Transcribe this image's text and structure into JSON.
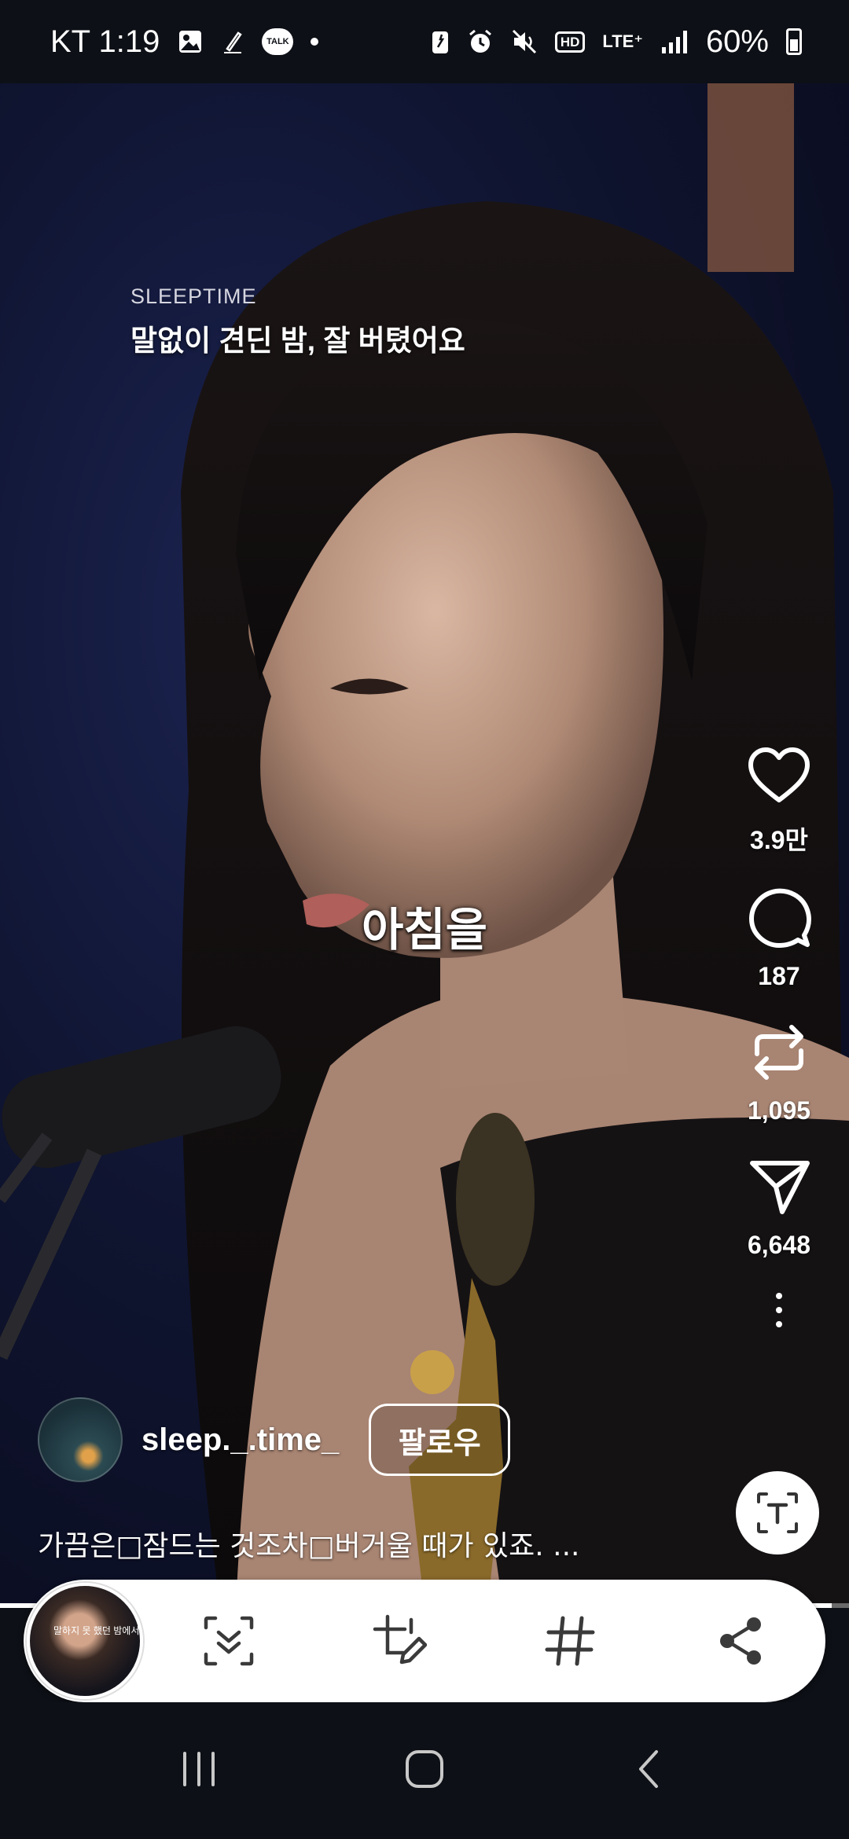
{
  "status_bar": {
    "carrier_time": "KT 1:19",
    "talk_label": "TALK",
    "hd_label": "HD",
    "network_label": "LTE⁺",
    "battery_percent": "60%"
  },
  "video": {
    "brand": "SLEEPTIME",
    "headline": "말없이 견딘 밤, 잘 버텼어요",
    "caption": "아침을",
    "thumb_text": "말하지 못 했던 밤에서"
  },
  "actions": {
    "likes": "3.9만",
    "comments": "187",
    "reposts": "1,095",
    "shares": "6,648"
  },
  "author": {
    "username": "sleep._.time_",
    "follow_label": "팔로우"
  },
  "description": "가끔은□잠드는 것조차□버거울 때가 있죠. ...",
  "progress": 0.98,
  "icons": {
    "like": "heart-icon",
    "comment": "comment-icon",
    "repost": "repost-icon",
    "share": "send-icon",
    "more": "more-vertical-icon",
    "text_extract": "text-extract-icon",
    "scroll_capture": "scroll-capture-icon",
    "draw": "crop-draw-icon",
    "tag": "hashtag-icon",
    "share_capture": "share-icon"
  }
}
